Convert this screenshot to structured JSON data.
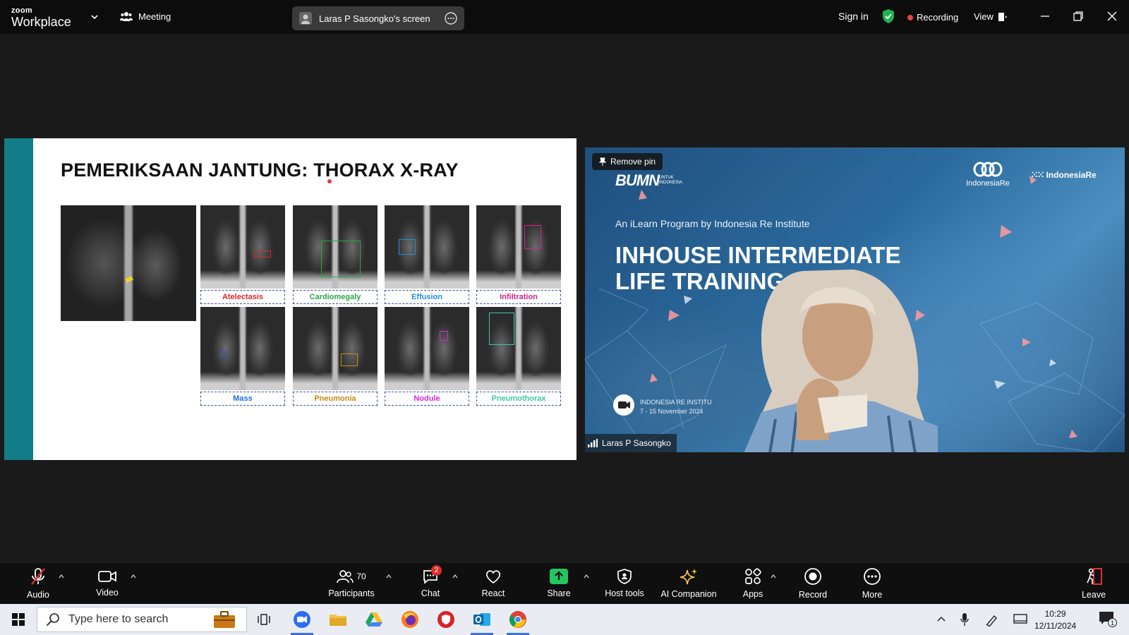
{
  "zoom": {
    "logo_small": "zoom",
    "logo_big": "Workplace",
    "meeting_label": "Meeting",
    "screen_share_label": "Laras P Sasongko's screen",
    "sign_in": "Sign in",
    "recording": "Recording",
    "view": "View"
  },
  "slide": {
    "title": "PEMERIKSAAN JANTUNG: THORAX X-RAY",
    "findings": [
      "Atelectasis",
      "Cardiomegaly",
      "Effusion",
      "Infiltration",
      "Mass",
      "Pneumonia",
      "Nodule",
      "Pneumothorax"
    ],
    "label_colors": [
      "#e0242c",
      "#2aa84a",
      "#1f8fd6",
      "#d2248f",
      "#1f6fd6",
      "#c98a12",
      "#d02ad6",
      "#3fc7a8"
    ]
  },
  "video": {
    "remove_pin": "Remove pin",
    "bumn": "BUMN",
    "bumn_sub_1": "UNTUK",
    "bumn_sub_2": "INDONESIA",
    "indonesia_re": "IndonesiaRe",
    "indonesia_re_inst": "IndonesiaRe",
    "subtitle": "An iLearn Program by Indonesia Re Institute",
    "headline_1": "INHOUSE INTERMEDIATE",
    "headline_2": "LIFE TRAINING 2",
    "institute_line": "INDONESIA RE INSTITU",
    "date_line": "7 - 15 November 2024",
    "participant_name": "Laras P Sasongko"
  },
  "toolbar": {
    "audio": "Audio",
    "video": "Video",
    "participants": "Participants",
    "participants_count": "70",
    "chat": "Chat",
    "chat_badge": "2",
    "react": "React",
    "share": "Share",
    "host_tools": "Host tools",
    "ai_companion": "AI Companion",
    "apps": "Apps",
    "record": "Record",
    "more": "More",
    "leave": "Leave"
  },
  "taskbar": {
    "search_placeholder": "Type here to search",
    "time": "10:29",
    "date": "12/11/2024",
    "notification_count": "1"
  },
  "colors": {
    "slide_bar": "#127d88",
    "recording_dot": "#e74444",
    "share_green": "#22c55e",
    "shield_green": "#1fb250",
    "taskbar_bg": "#e9edf3"
  }
}
